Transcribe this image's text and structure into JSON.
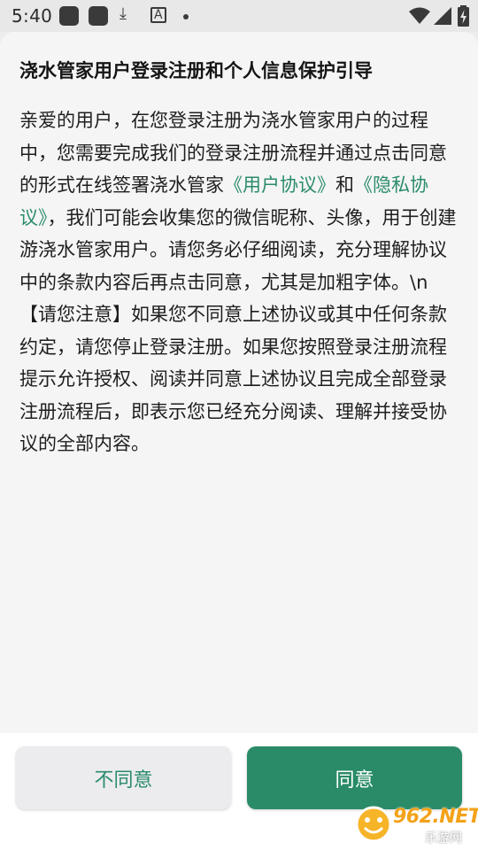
{
  "status_bar": {
    "time": "5:40"
  },
  "dialog": {
    "title": "浇水管家用户登录注册和个人信息保护引导",
    "body": {
      "text_1": "亲爱的用户，在您登录注册为浇水管家用户的过程中，您需要完成我们的登录注册流程并通过点击同意的形式在线签署浇水管家",
      "user_agreement_link": "《用户协议》",
      "text_2": "和",
      "privacy_policy_link": "《隐私协议》",
      "text_3": "，我们可能会收集您的微信昵称、头像，用于创建游浇水管家用户。请您务必仔细阅读，充分理解协议中的条款内容后再点击同意，尤其是加粗字体。\\n【请您注意】如果您不同意上述协议或其中任何条款约定，请您停止登录注册。如果您按照登录注册流程提示允许授权、阅读并同意上述协议且完成全部登录注册流程后，即表示您已经充分阅读、理解并接受协议的全部内容。"
    }
  },
  "buttons": {
    "disagree_label": "不同意",
    "agree_label": "同意"
  },
  "watermark": {
    "top": "962.NET",
    "bottom": "乐游网"
  },
  "colors": {
    "accent": "#2a8b68",
    "link": "#2a8b6b",
    "sheet_background": "#f5f5f5"
  }
}
